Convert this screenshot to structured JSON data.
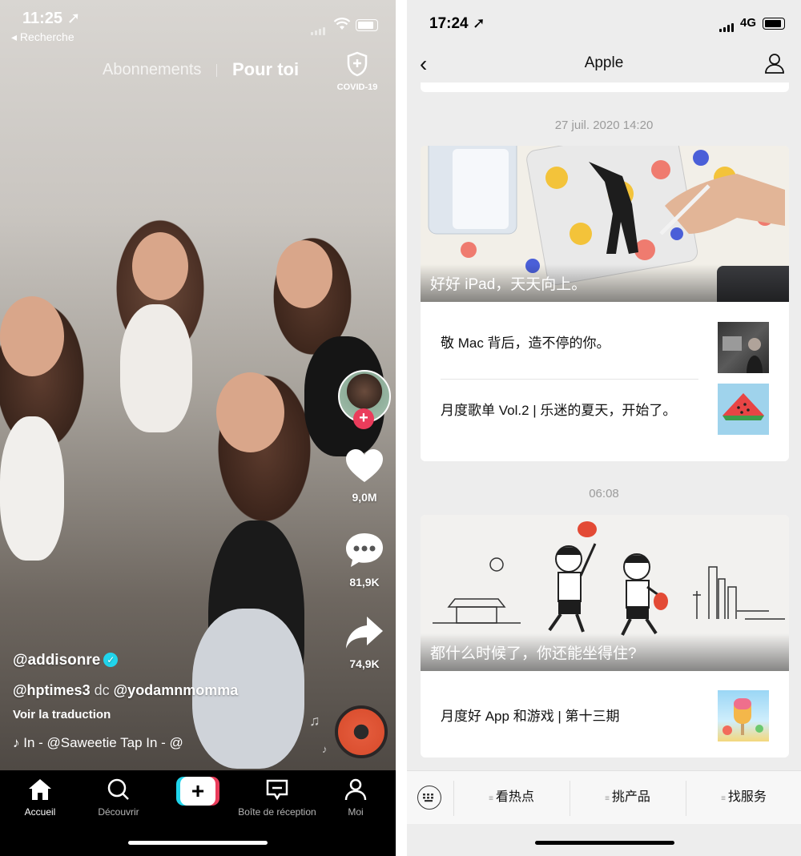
{
  "tiktok": {
    "status": {
      "time": "11:25 ➚",
      "back_label": "◂ Recherche"
    },
    "tabs": {
      "following": "Abonnements",
      "for_you": "Pour toi"
    },
    "covid_label": "COVID-19",
    "actions": {
      "likes": "9,0M",
      "comments": "81,9K",
      "shares": "74,9K"
    },
    "username": "@addisonre",
    "caption": {
      "mention1": "@hptimes3",
      "dc": "dc",
      "mention2": "@yodamnmomma"
    },
    "translate": "Voir la traduction",
    "sound": "♪  In - @Saweetie    Tap In - @",
    "nav": [
      {
        "label": "Accueil",
        "icon": "home-icon"
      },
      {
        "label": "Découvrir",
        "icon": "search-icon"
      },
      {
        "label": "+",
        "icon": "create-icon"
      },
      {
        "label": "Boîte de réception",
        "icon": "inbox-icon"
      },
      {
        "label": "Moi",
        "icon": "profile-icon"
      }
    ],
    "colors": {
      "accent_red": "#ea3c5b",
      "accent_cyan": "#20d5ec"
    }
  },
  "wechat": {
    "status": {
      "time": "17:24 ➚",
      "network": "4G"
    },
    "header": {
      "title": "Apple",
      "back": "‹"
    },
    "groups": [
      {
        "date": "27 juil. 2020 14:20",
        "hero_title": "好好 iPad，天天向上。",
        "items": [
          {
            "title": "敬 Mac 背后，造不停的你。",
            "thumb": "dark-desk-photo"
          },
          {
            "title": "月度歌单 Vol.2 | 乐迷的夏天，开始了。",
            "thumb": "watermelon-illustration"
          }
        ]
      },
      {
        "date": "06:08",
        "hero_title": "都什么时候了，你还能坐得住?",
        "items": [
          {
            "title": "月度好 App 和游戏 | 第十三期",
            "thumb": "popsicle-illustration"
          }
        ]
      }
    ],
    "menu": [
      {
        "label": "看热点"
      },
      {
        "label": "挑产品"
      },
      {
        "label": "找服务"
      }
    ]
  }
}
